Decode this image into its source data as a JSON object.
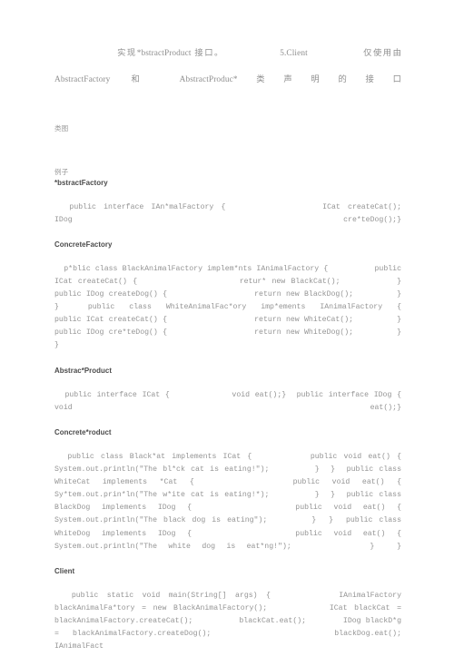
{
  "document": {
    "intro": {
      "line1": "                  实现*bstractProduct 接口。                5.Client                仅使用由",
      "line2": "AbstractFactory 和 AbstractProduc*类声明的接口"
    },
    "class_diagram_label": "类图",
    "example_label": "例子",
    "sections": [
      {
        "heading": "*bstractFactory",
        "code": "  public interface IAn*malFactory {             ICat createCat();                          IDog cre*teDog();}"
      },
      {
        "heading": "ConcreteFactory",
        "code": "  p*blic class BlackAnimalFactory implem*nts IAnimalFactory {          public ICat createCat() {                  retur* new BlackCat();          }          public IDog createDog() {                  return new BlackDog();         }  }  public class WhiteAnimalFac*ory imp*ements IAnimalFactory {          public ICat createCat() {                  return new WhiteCat();         }          public IDog cre*teDog() {                  return new WhiteDog();         }  }"
      },
      {
        "heading": "Abstrac*Product",
        "code": "  public interface ICat {            void eat();}  public interface IDog {        void eat();}"
      },
      {
        "heading": "Concrete*roduct",
        "code": "  public class Black*at implements ICat {         public void eat() {              System.out.println(\"The bl*ck cat is eating!\");        }  }  public class WhiteCat implements *Cat {        public void eat() {               Sy*tem.out.prin*ln(\"The w*ite cat is eating!*);        }  }  public class BlackDog implements IDog {         public void eat() {              System.out.println(\"The black dog is eating\");       }  }  public class WhiteDog implements IDog {         public void eat() {              System.out.println(\"The white dog is eat*ng!\");       }  }"
      },
      {
        "heading": "Client",
        "code": "  public static void main(String[] args) {        IAnimalFactory blackAnimalFa*tory = new BlackAnimalFactory();         ICat blackCat = blackAnimalFactory.createCat();          blackCat.eat();        IDog blackD*g = blackAnimalFactory.createDog();         blackDog.eat();                       IAnimalFact"
      }
    ]
  }
}
